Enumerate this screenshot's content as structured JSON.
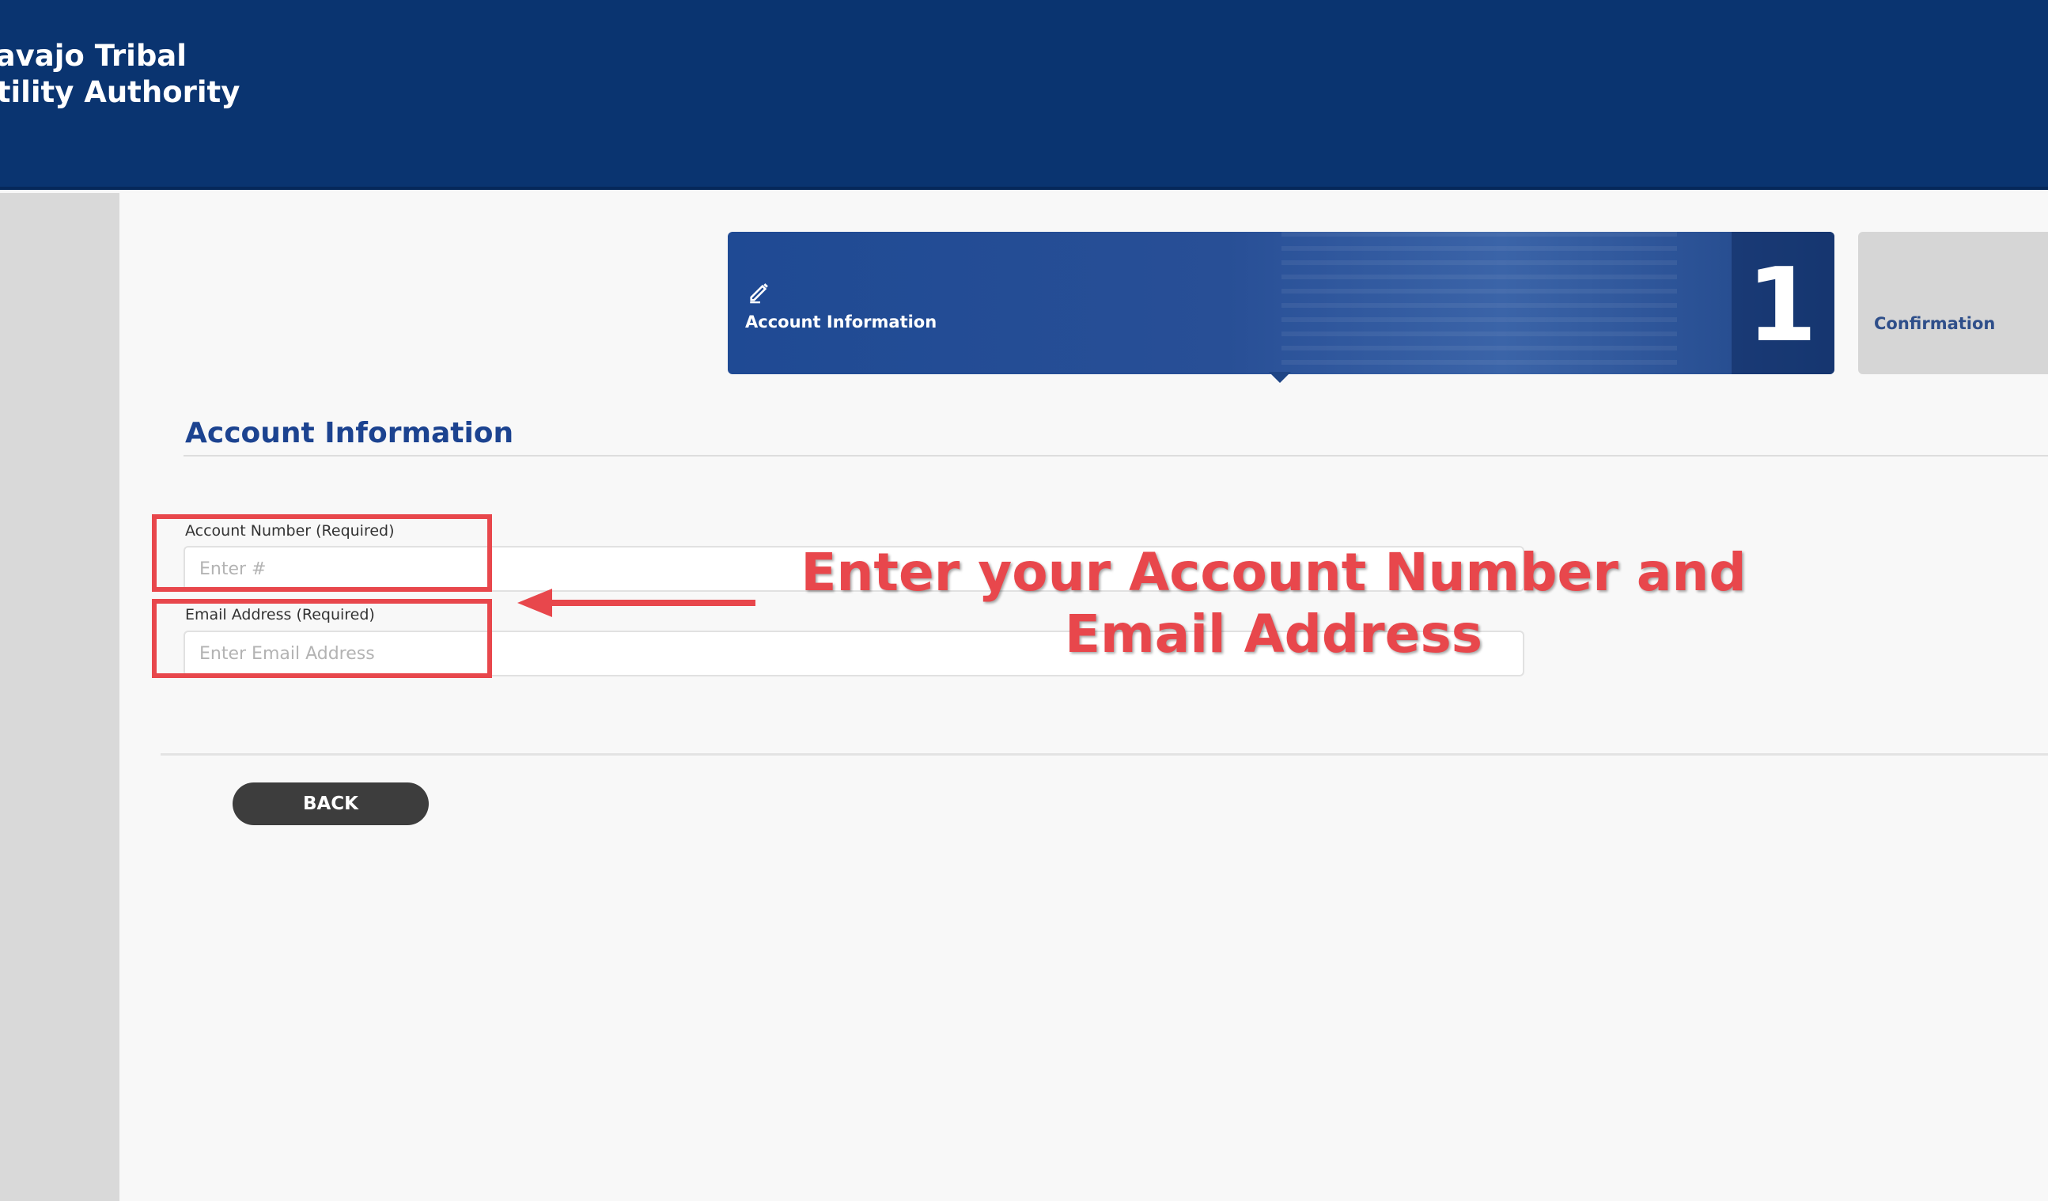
{
  "header": {
    "logo_text": "lavajo Tribal\nJtility Authority"
  },
  "steps": [
    {
      "label": "Account Information",
      "number": "1",
      "icon": "pencil-icon",
      "active": true
    },
    {
      "label": "Confirmation",
      "active": false
    }
  ],
  "section": {
    "title": "Account Information"
  },
  "form": {
    "account_number": {
      "label": "Account Number (Required)",
      "placeholder": "Enter #",
      "value": ""
    },
    "email": {
      "label": "Email Address (Required)",
      "placeholder": "Enter Email Address",
      "value": ""
    }
  },
  "annotation": {
    "text": "Enter your Account Number and\nEmail Address",
    "color": "#e8474c"
  },
  "buttons": {
    "back_label": "BACK"
  },
  "colors": {
    "header_bg": "#0a3470",
    "accent_blue": "#1c4390",
    "button_dark": "#3d3d3d"
  }
}
